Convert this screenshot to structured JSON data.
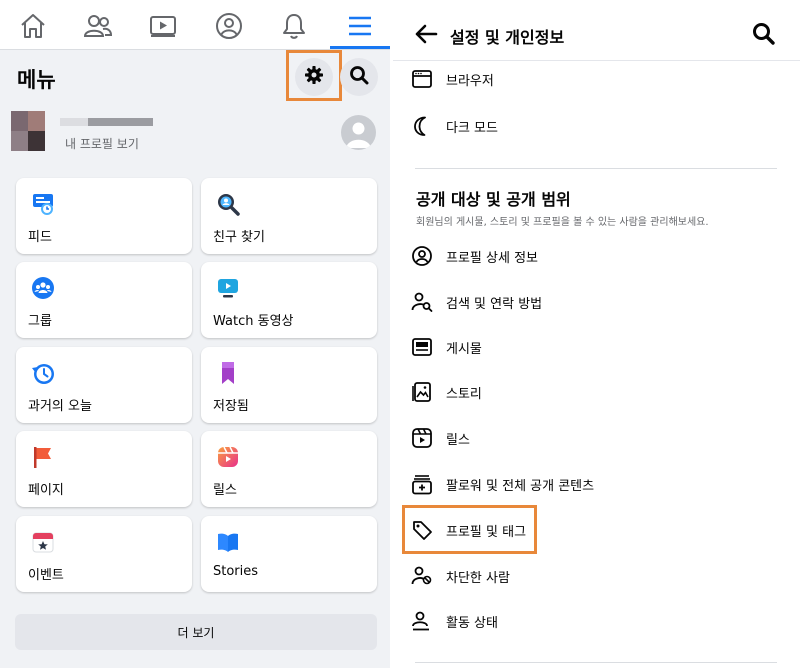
{
  "colors": {
    "accent": "#1877f2",
    "highlight": "#e8883a",
    "panel_bg": "#f0f2f5",
    "muted_text": "#65676b"
  },
  "left": {
    "nav": [
      {
        "name": "home-icon"
      },
      {
        "name": "friends-icon"
      },
      {
        "name": "watch-icon"
      },
      {
        "name": "profile-icon"
      },
      {
        "name": "bell-icon"
      },
      {
        "name": "hamburger-menu-icon",
        "active": true
      }
    ],
    "menu_title": "메뉴",
    "profile": {
      "subtitle": "내 프로필 보기"
    },
    "tiles": [
      {
        "label": "피드",
        "icon": "feed-icon"
      },
      {
        "label": "친구 찾기",
        "icon": "find-friends-icon"
      },
      {
        "label": "그룹",
        "icon": "groups-icon"
      },
      {
        "label": "Watch 동영상",
        "icon": "watch-video-icon"
      },
      {
        "label": "과거의 오늘",
        "icon": "memories-icon"
      },
      {
        "label": "저장됨",
        "icon": "saved-icon"
      },
      {
        "label": "페이지",
        "icon": "pages-icon"
      },
      {
        "label": "릴스",
        "icon": "reels-icon"
      },
      {
        "label": "이벤트",
        "icon": "events-icon"
      },
      {
        "label": "Stories",
        "icon": "stories-icon"
      }
    ],
    "more_label": "더 보기"
  },
  "right": {
    "title": "설정 및 개인정보",
    "rows_top": [
      {
        "label": "브라우저",
        "icon": "browser-icon"
      },
      {
        "label": "다크 모드",
        "icon": "moon-icon"
      }
    ],
    "section": {
      "title": "공개 대상 및 공개 범위",
      "description": "회원님의 게시물, 스토리 및 프로필을 볼 수 있는 사람을 관리해보세요."
    },
    "rows": [
      {
        "label": "프로필 상세 정보",
        "icon": "user-circle-icon"
      },
      {
        "label": "검색 및 연락 방법",
        "icon": "user-search-icon"
      },
      {
        "label": "게시물",
        "icon": "posts-icon"
      },
      {
        "label": "스토리",
        "icon": "story-icon"
      },
      {
        "label": "릴스",
        "icon": "reels-outline-icon"
      },
      {
        "label": "팔로워 및 전체 공개 콘텐츠",
        "icon": "follower-add-icon"
      },
      {
        "label": "프로필 및 태그",
        "icon": "tag-icon"
      },
      {
        "label": "차단한 사람",
        "icon": "block-user-icon"
      },
      {
        "label": "활동 상태",
        "icon": "activity-user-icon"
      }
    ]
  }
}
